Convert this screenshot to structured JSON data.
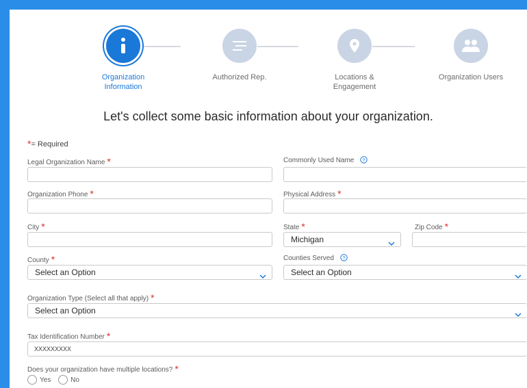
{
  "stepper": [
    {
      "label": "Organization\nInformation",
      "icon": "info-icon",
      "active": true
    },
    {
      "label": "Authorized Rep.",
      "icon": "list-icon",
      "active": false
    },
    {
      "label": "Locations &\nEngagement",
      "icon": "location-pin-icon",
      "active": false
    },
    {
      "label": "Organization Users",
      "icon": "users-icon",
      "active": false
    }
  ],
  "heading": "Let's collect some basic information about your organization.",
  "required_note": "= Required",
  "required_marker": "*",
  "fields": {
    "legal_name": {
      "label": "Legal Organization Name",
      "value": ""
    },
    "common_name": {
      "label": "Commonly Used Name",
      "value": ""
    },
    "phone": {
      "label": "Organization Phone",
      "value": ""
    },
    "address": {
      "label": "Physical Address",
      "value": ""
    },
    "city": {
      "label": "City",
      "value": ""
    },
    "state": {
      "label": "State",
      "value": "Michigan"
    },
    "zip": {
      "label": "Zip Code",
      "value": ""
    },
    "county": {
      "label": "County",
      "value": "Select an Option"
    },
    "counties_served": {
      "label": "Counties Served",
      "value": "Select an Option"
    },
    "org_type": {
      "label": "Organization Type (Select all that apply)",
      "value": "Select an Option"
    },
    "tax_id": {
      "label": "Tax Identification Number",
      "value": "XXXXXXXXX"
    },
    "multiple_locations": {
      "label": "Does your organization have multiple locations?",
      "options": [
        "Yes",
        "No"
      ]
    }
  },
  "colors": {
    "accent": "#1a78d8",
    "required": "#d9302c",
    "frame": "#2a8ee8"
  }
}
